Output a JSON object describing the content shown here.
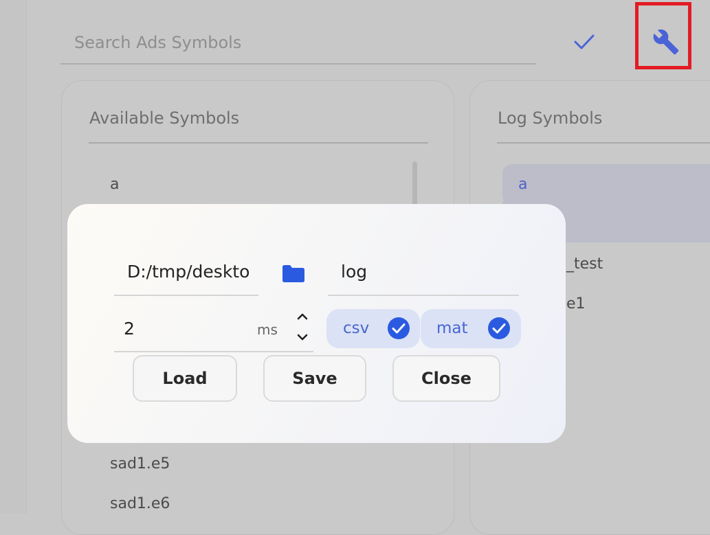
{
  "search": {
    "placeholder": "Search Ads Symbols"
  },
  "toolbar": {
    "confirm_icon": "check-icon",
    "settings_icon": "wrench-icon",
    "highlight_color": "#e31b23",
    "accent_color": "#4a63d6"
  },
  "available_panel": {
    "title": "Available Symbols",
    "items_top": [
      {
        "label": "a"
      }
    ],
    "items_bottom": [
      {
        "label": "sad1.e5"
      },
      {
        "label": "sad1.e6"
      }
    ]
  },
  "log_panel": {
    "title": "Log Symbols",
    "items": [
      {
        "label": "a",
        "selected": true
      },
      {
        "label": "_test"
      },
      {
        "label": "e1"
      }
    ]
  },
  "dialog": {
    "path_value": "D:/tmp/desktop",
    "folder_icon": "folder-icon",
    "name_value": "log",
    "interval_value": "2",
    "interval_unit": "ms",
    "formats": [
      {
        "label": "csv",
        "checked": true
      },
      {
        "label": "mat",
        "checked": true
      }
    ],
    "buttons": {
      "load": "Load",
      "save": "Save",
      "close": "Close"
    }
  }
}
